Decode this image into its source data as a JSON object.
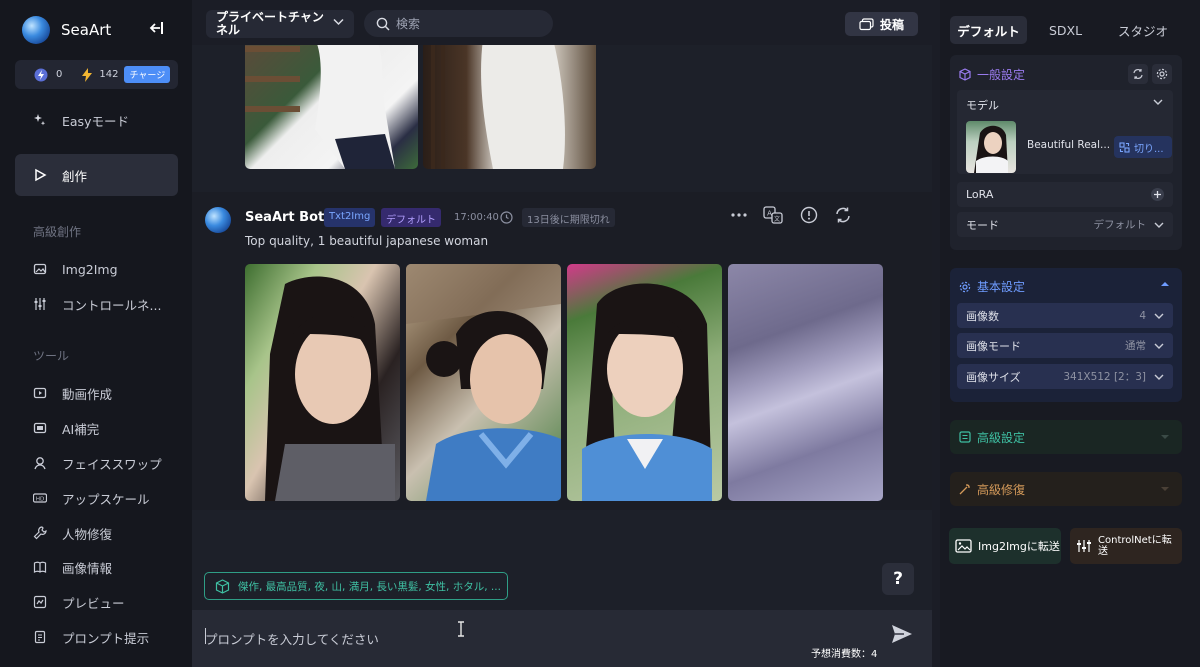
{
  "app": {
    "brand": "SeaArt"
  },
  "credits": {
    "bolt_count": "0",
    "flash_count": "142",
    "charge_label": "チャージ"
  },
  "sidebar": {
    "easy_mode": "Easyモード",
    "create": "創作",
    "section_advanced": "高級創作",
    "img2img": "Img2Img",
    "controlnet": "コントロールネ...",
    "section_tools": "ツール",
    "tools": [
      "動画作成",
      "AI補完",
      "フェイススワップ",
      "アップスケール",
      "人物修復",
      "画像情報",
      "プレビュー",
      "プロンプト提示"
    ]
  },
  "topbar": {
    "channel_line1": "プライベートチャン",
    "channel_line2": "ネル",
    "search_placeholder": "検索",
    "post_label": "投稿"
  },
  "message": {
    "bot_name": "SeaArt Bot",
    "tag_mode": "Txt2Img",
    "tag_preset": "デフォルト",
    "time": "17:00:40",
    "expiry": "13日後に期限切れ",
    "prompt": "Top quality, 1 beautiful japanese woman"
  },
  "suggestion": "傑作, 最高品質, 夜, 山, 満月, 長い黒髪, 女性, ホタル, ...",
  "help_label": "?",
  "input": {
    "placeholder": "プロンプトを入力してください",
    "cost": "予想消費数：4"
  },
  "right_panel": {
    "tabs": [
      "デフォルト",
      "SDXL",
      "スタジオ"
    ],
    "general": {
      "title": "一般設定",
      "model_label": "モデル",
      "model_name": "Beautiful Real...",
      "switch_label": "切り...",
      "lora_label": "LoRA",
      "mode_label": "モード",
      "mode_value": "デフォルト"
    },
    "basic": {
      "title": "基本設定",
      "count_label": "画像数",
      "count_value": "4",
      "image_mode_label": "画像モード",
      "image_mode_value": "通常",
      "size_label": "画像サイズ",
      "size_value": "341X512 [2：3]"
    },
    "advanced_title": "高級設定",
    "repair_title": "高級修復",
    "to_img2img": "Img2Imgに転送",
    "to_controlnet_line1": "ControlNetに転",
    "to_controlnet_line2": "送"
  },
  "colors": {
    "accent_blue": "#4d8ef7",
    "teal": "#3fc0a3",
    "purple": "#9b7cf0",
    "orange": "#d49a5a"
  }
}
